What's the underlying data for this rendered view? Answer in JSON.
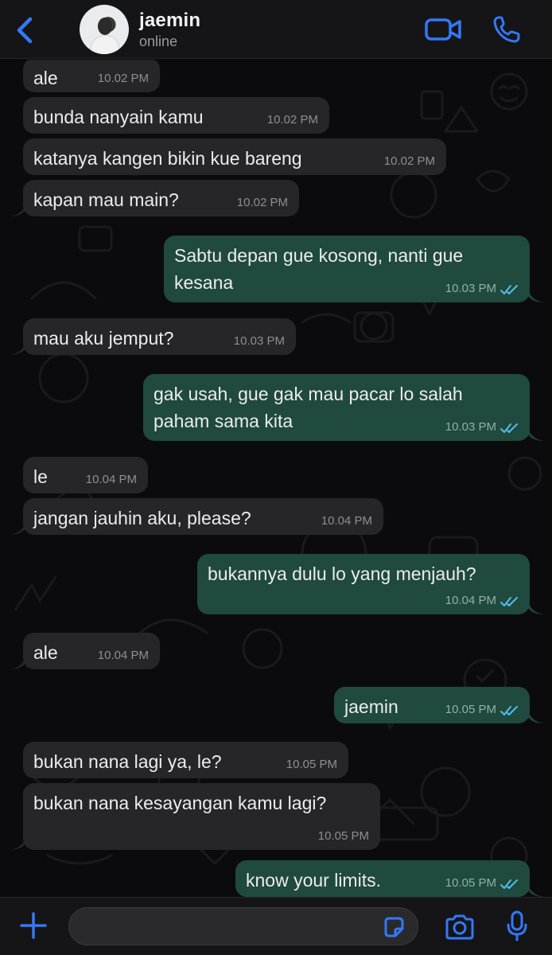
{
  "header": {
    "back_icon": "chevron-left-icon",
    "contact_name": "jaemin",
    "status": "online",
    "video_icon": "video-camera-icon",
    "call_icon": "phone-icon"
  },
  "colors": {
    "accent": "#3478f6",
    "incoming_bubble": "#262629",
    "outgoing_bubble": "#1f4a3d",
    "read_ticks": "#53bdeb"
  },
  "messages": [
    {
      "direction": "in",
      "text": "ale",
      "time": "10.02 PM"
    },
    {
      "direction": "in",
      "text": "bunda nanyain kamu",
      "time": "10.02 PM"
    },
    {
      "direction": "in",
      "text": "katanya kangen bikin kue bareng",
      "time": "10.02 PM"
    },
    {
      "direction": "in",
      "text": "kapan mau main?",
      "time": "10.02 PM"
    },
    {
      "direction": "out",
      "text": "Sabtu depan gue kosong, nanti gue kesana",
      "time": "10.03 PM",
      "read": true
    },
    {
      "direction": "in",
      "text": "mau aku jemput?",
      "time": "10.03 PM"
    },
    {
      "direction": "out",
      "text": "gak usah, gue gak mau pacar lo salah paham sama kita",
      "time": "10.03 PM",
      "read": true
    },
    {
      "direction": "in",
      "text": "le",
      "time": "10.04 PM"
    },
    {
      "direction": "in",
      "text": "jangan jauhin aku, please?",
      "time": "10.04 PM"
    },
    {
      "direction": "out",
      "text": "bukannya dulu lo yang menjauh?",
      "time": "10.04 PM",
      "read": true
    },
    {
      "direction": "in",
      "text": "ale",
      "time": "10.04 PM"
    },
    {
      "direction": "out",
      "text": "jaemin",
      "time": "10.05 PM",
      "read": true
    },
    {
      "direction": "in",
      "text": "bukan nana lagi ya, le?",
      "time": "10.05 PM"
    },
    {
      "direction": "in",
      "text": "bukan nana kesayangan kamu lagi?",
      "time": "10.05 PM"
    },
    {
      "direction": "out",
      "text": "know your limits.",
      "time": "10.05 PM",
      "read": true
    }
  ],
  "composer": {
    "placeholder": "",
    "value": "",
    "plus_icon": "plus-icon",
    "sticker_icon": "sticker-icon",
    "camera_icon": "camera-icon",
    "mic_icon": "microphone-icon"
  }
}
